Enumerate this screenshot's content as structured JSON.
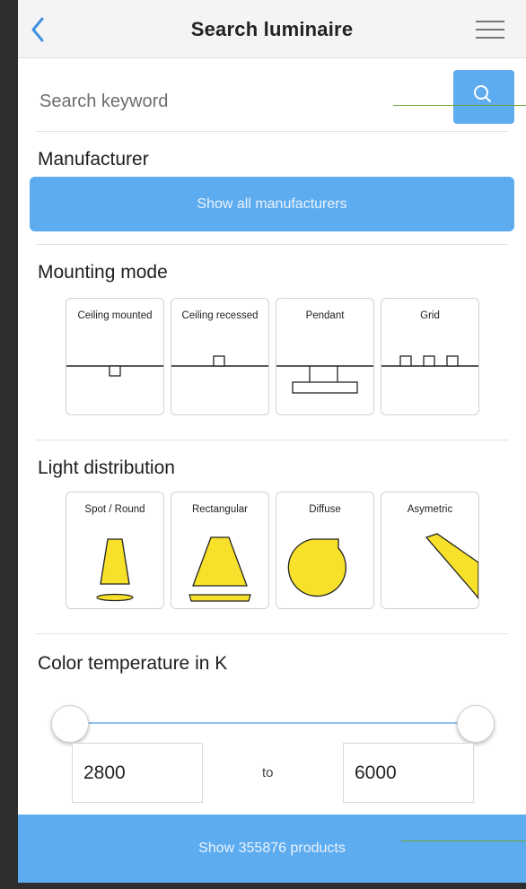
{
  "header": {
    "title": "Search luminaire",
    "back_icon": "chevron-left-icon",
    "menu_icon": "hamburger-menu-icon"
  },
  "search": {
    "placeholder": "Search keyword",
    "value": "",
    "button_icon": "search-icon"
  },
  "manufacturer": {
    "title": "Manufacturer",
    "button_label": "Show all manufacturers"
  },
  "mounting_mode": {
    "title": "Mounting mode",
    "options": [
      {
        "label": "Ceiling mounted",
        "icon": "ceiling-mounted-icon"
      },
      {
        "label": "Ceiling recessed",
        "icon": "ceiling-recessed-icon"
      },
      {
        "label": "Pendant",
        "icon": "pendant-icon"
      },
      {
        "label": "Grid",
        "icon": "grid-icon"
      }
    ]
  },
  "light_distribution": {
    "title": "Light distribution",
    "options": [
      {
        "label": "Spot / Round",
        "icon": "spot-round-icon"
      },
      {
        "label": "Rectangular",
        "icon": "rectangular-icon"
      },
      {
        "label": "Diffuse",
        "icon": "diffuse-icon"
      },
      {
        "label": "Asymetric",
        "icon": "asymmetric-icon"
      }
    ]
  },
  "color_temperature": {
    "title": "Color temperature in K",
    "min": "2800",
    "to_label": "to",
    "max": "6000"
  },
  "footer": {
    "button_label": "Show 355876 products"
  },
  "colors": {
    "accent": "#5eacf0",
    "tile_fill": "#f7e12a",
    "back_icon": "#3f8fe0"
  }
}
